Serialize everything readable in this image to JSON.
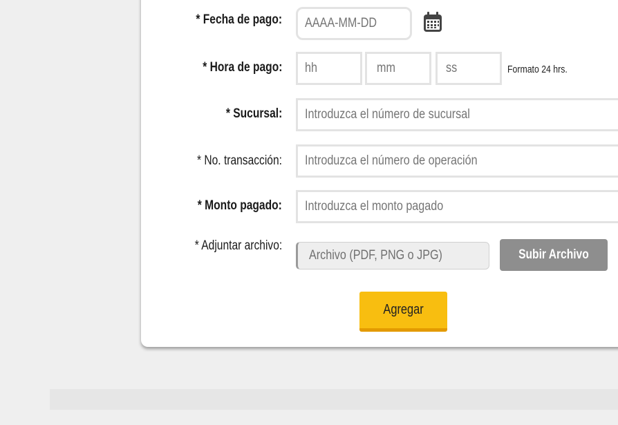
{
  "form": {
    "fecha_label": "* Fecha de pago:",
    "fecha_placeholder": "AAAA-MM-DD",
    "hora_label": "* Hora de pago:",
    "hora_hh": "hh",
    "hora_mm": "mm",
    "hora_ss": "ss",
    "hora_note": "Formato 24 hrs.",
    "sucursal_label": "* Sucursal:",
    "sucursal_placeholder": "Introduzca el número de sucursal",
    "transaccion_label": "* No. transacción:",
    "transaccion_placeholder": "Introduzca el número de operación",
    "monto_label": "* Monto pagado:",
    "monto_placeholder": "Introduzca el monto pagado",
    "archivo_label": "* Adjuntar archivo:",
    "archivo_placeholder": "Archivo (PDF, PNG o JPG)",
    "upload_label": "Subir Archivo",
    "submit_label": "Agregar"
  },
  "icons": {
    "calendar": "calendar-icon"
  },
  "colors": {
    "primary_button": "#f8be10",
    "secondary_button": "#8e8e8e"
  }
}
